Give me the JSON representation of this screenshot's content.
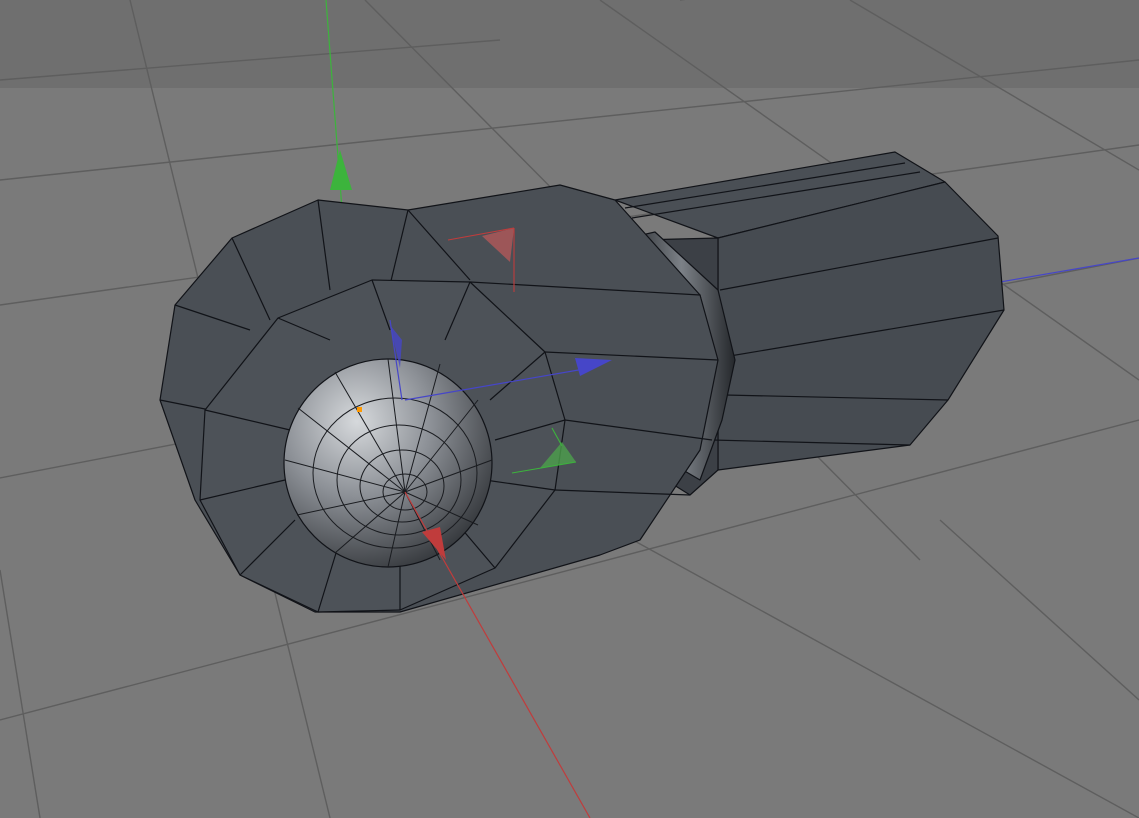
{
  "viewport": {
    "view": "perspective-3d",
    "background_top_color": "#6f6f6f",
    "background_color": "#7a7a7a",
    "grid_color": "#5e5e5e"
  },
  "model": {
    "body_color": "#4a4f55",
    "body_dark_color": "#3c4046",
    "edge_color": "#111318",
    "sphere_color": "#8c9096"
  },
  "gizmo": {
    "x_axis_color": "#c03c3c",
    "y_axis_color": "#3cb43c",
    "z_axis_color": "#4646c8",
    "pivot_point_color": "#ff9900"
  }
}
